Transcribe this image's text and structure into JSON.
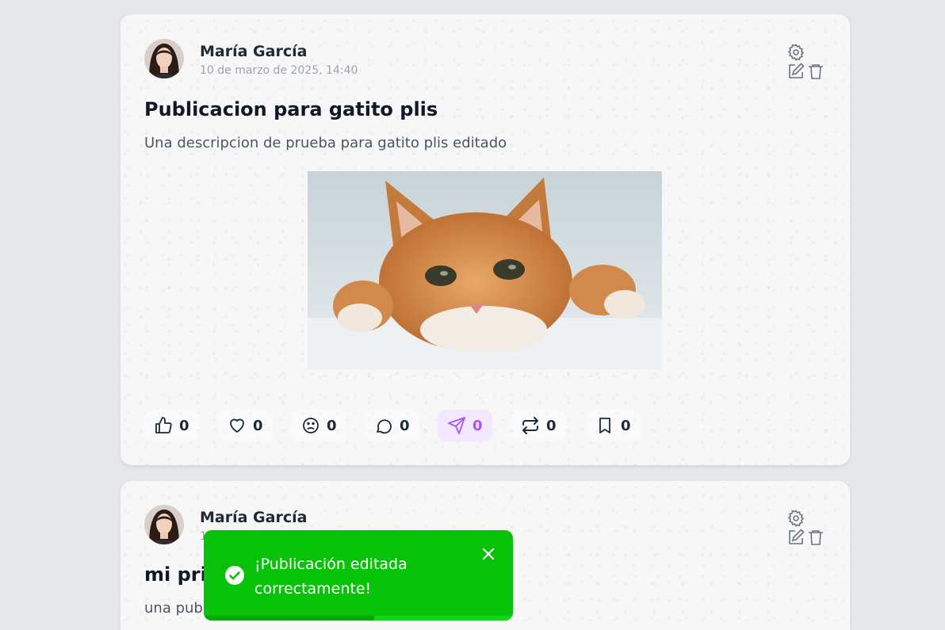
{
  "posts": [
    {
      "author": "María García",
      "date": "10 de marzo de 2025, 14:40",
      "title": "Publicacion para gatito plis",
      "description": "Una descripcion de prueba para gatito plis editado",
      "image": "orange-tabby-cat-photo",
      "reactions": [
        {
          "icon": "thumbs-up-icon",
          "count": "0"
        },
        {
          "icon": "heart-icon",
          "count": "0"
        },
        {
          "icon": "sad-face-icon",
          "count": "0"
        },
        {
          "icon": "comment-icon",
          "count": "0"
        },
        {
          "icon": "send-icon",
          "count": "0",
          "active": true
        },
        {
          "icon": "repost-icon",
          "count": "0"
        },
        {
          "icon": "bookmark-icon",
          "count": "0"
        }
      ]
    },
    {
      "author": "María García",
      "date_visible": "1",
      "title_visible": "mi pri",
      "description_visible": "una publ"
    }
  ],
  "toast": {
    "message_line1": "¡Publicación editada",
    "message_line2": "correctamente!",
    "type": "success",
    "color": "#08c20a",
    "progress": 0.55
  },
  "colors": {
    "background": "#e5e7eb",
    "card": "#f7f7f7",
    "accent": "#a855f7",
    "muted": "#9ca3af"
  }
}
